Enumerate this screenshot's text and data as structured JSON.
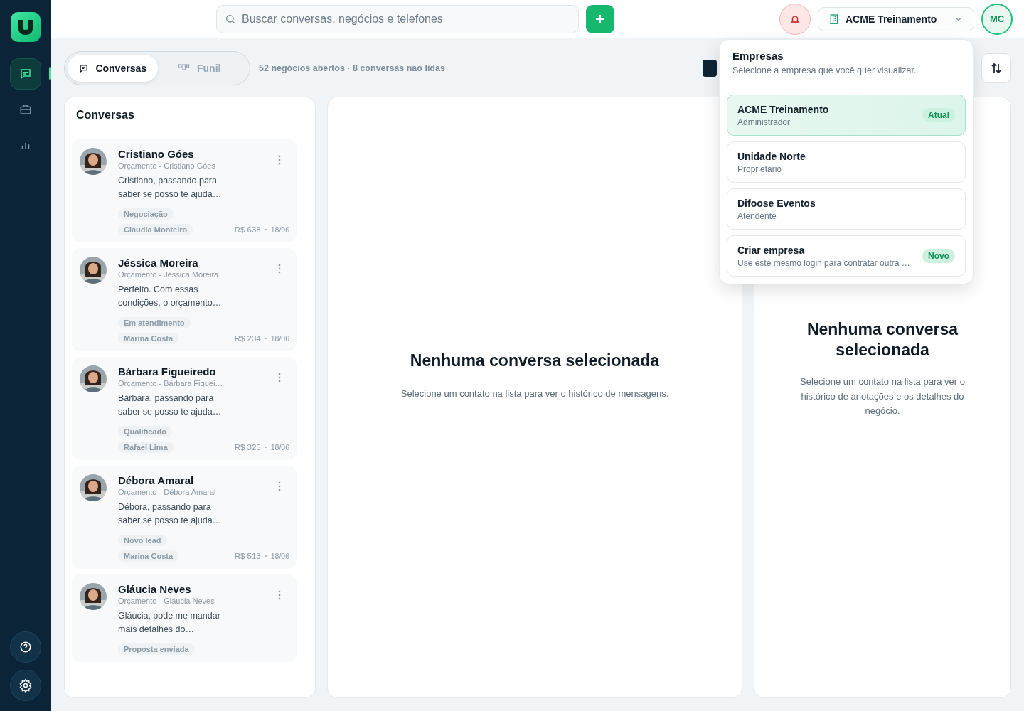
{
  "nav": [
    {
      "selected": true
    },
    {
      "selected": false
    },
    {
      "selected": false
    }
  ],
  "search": {
    "placeholder": "Buscar conversas, negócios e telefones"
  },
  "company_select": {
    "value": "ACME Treinamento"
  },
  "user": {
    "initials": "MC"
  },
  "view_tabs": [
    {
      "label": "Conversas",
      "selected": true
    },
    {
      "label": "Funil",
      "selected": false
    }
  ],
  "summary": "52 negócios abertos · 8 conversas não lidas",
  "list": {
    "title": "Conversas",
    "items": [
      {
        "name": "Cristiano Góes",
        "subtitle": "Orçamento - Cristiano Góes",
        "preview": "Cristiano, passando para saber se posso te ajuda…",
        "stage": "Negociação",
        "owner": "Cláudia Monteiro",
        "value": "R$ 638",
        "date": "18/06"
      },
      {
        "name": "Jéssica Moreira",
        "subtitle": "Orçamento - Jéssica Moreira",
        "preview": "Perfeito. Com essas condições, o orçamento…",
        "stage": "Em atendimento",
        "owner": "Marina Costa",
        "value": "R$ 234",
        "date": "18/06"
      },
      {
        "name": "Bárbara Figueiredo",
        "subtitle": "Orçamento - Bárbara Figuei…",
        "preview": "Bárbara, passando para saber se posso te ajuda…",
        "stage": "Qualificado",
        "owner": "Rafael Lima",
        "value": "R$ 325",
        "date": "18/06"
      },
      {
        "name": "Débora Amaral",
        "subtitle": "Orçamento - Débora Amaral",
        "preview": "Débora, passando para saber se posso te ajuda…",
        "stage": "Novo lead",
        "owner": "Marina Costa",
        "value": "R$ 513",
        "date": "18/06"
      },
      {
        "name": "Gláucia Neves",
        "subtitle": "Orçamento - Gláucia Neves",
        "preview": "Gláucia, pode me mandar mais detalhes do…",
        "stage": "Proposta enviada"
      }
    ]
  },
  "chat_empty": {
    "title": "Nenhuma conversa selecionada",
    "text": "Selecione um contato na lista para ver o histórico de mensagens."
  },
  "details_empty": {
    "title": "Nenhuma conversa selecionada",
    "text": "Selecione um contato na lista para ver o histórico de anotações e os detalhes do negócio."
  },
  "dropdown": {
    "title": "Empresas",
    "subtitle": "Selecione a empresa que você quer visualizar.",
    "items": [
      {
        "name": "ACME Treinamento",
        "role": "Administrador",
        "badge": "Atual",
        "selected": true
      },
      {
        "name": "Unidade Norte",
        "role": "Proprietário",
        "selected": false
      },
      {
        "name": "Difoose Eventos",
        "role": "Atendente",
        "selected": false
      },
      {
        "name": "Criar empresa",
        "role": "Use este mesmo login para contratar outra …",
        "badge": "Novo",
        "selected": false
      }
    ]
  }
}
